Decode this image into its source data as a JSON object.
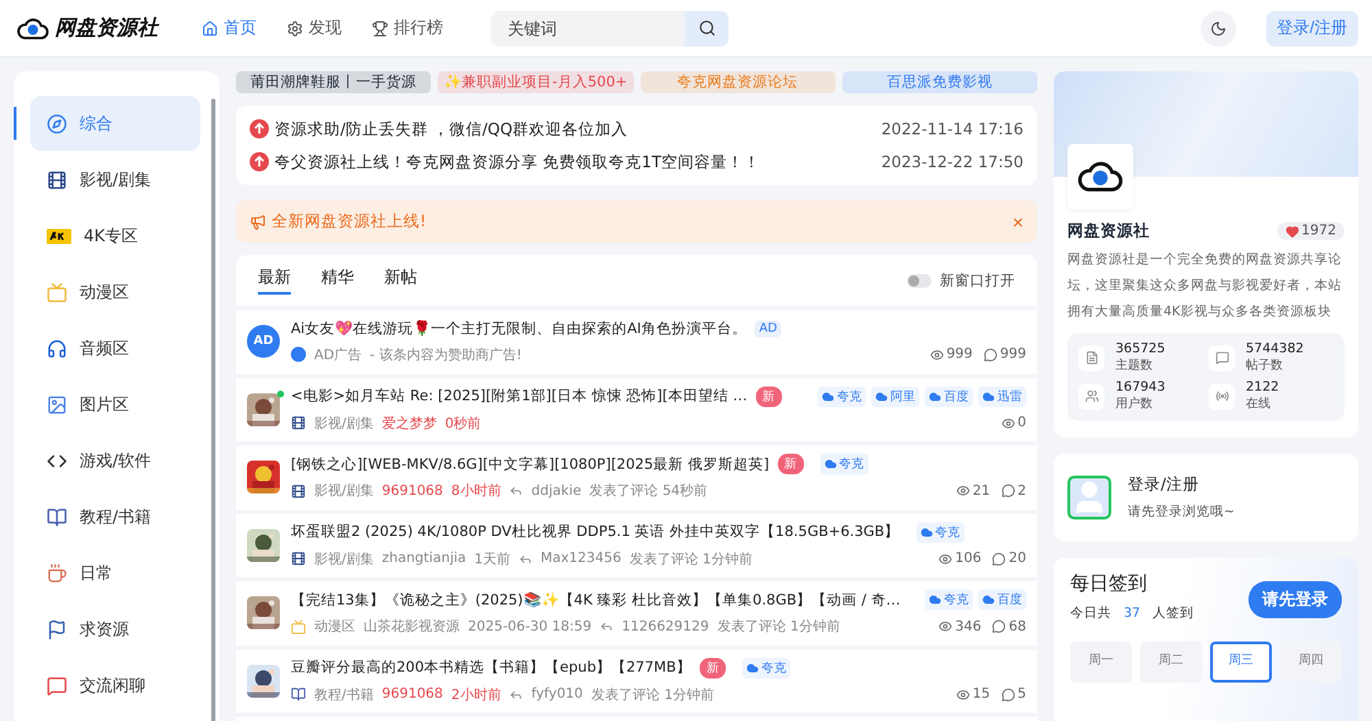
{
  "header": {
    "logo": "网盘资源社",
    "nav": [
      {
        "label": "首页",
        "selected": true
      },
      {
        "label": "发现",
        "selected": false
      },
      {
        "label": "排行榜",
        "selected": false
      }
    ],
    "search": {
      "placeholder": "关键词"
    },
    "login": "登录/注册"
  },
  "sidebar": {
    "items": [
      {
        "label": "综合",
        "selected": true
      },
      {
        "label": "影视/剧集",
        "selected": false
      },
      {
        "label": "4K专区",
        "selected": false
      },
      {
        "label": "动漫区",
        "selected": false
      },
      {
        "label": "音频区",
        "selected": false
      },
      {
        "label": "图片区",
        "selected": false
      },
      {
        "label": "游戏/软件",
        "selected": false
      },
      {
        "label": "教程/书籍",
        "selected": false
      },
      {
        "label": "日常",
        "selected": false
      },
      {
        "label": "求资源",
        "selected": false
      },
      {
        "label": "交流闲聊",
        "selected": false
      }
    ]
  },
  "promo_links": [
    {
      "label": "莆田潮牌鞋服丨一手货源",
      "color": "#1f2937"
    },
    {
      "label": "✨兼职副业项目-月入500+",
      "color": "#e5484d"
    },
    {
      "label": "夸克网盘资源论坛",
      "color": "#ea7a1a"
    },
    {
      "label": "百思派免费影视",
      "color": "#2f7bf0"
    }
  ],
  "announcements": [
    {
      "title": "资源求助/防止丢失群 ，微信/QQ群欢迎各位加入",
      "date": "2022-11-14 17:16"
    },
    {
      "title": "夸父资源社上线！夸克网盘资源分享 免费领取夸克1T空间容量！！",
      "date": "2023-12-22 17:50"
    }
  ],
  "notice": {
    "text": "全新网盘资源社上线!",
    "close": "×"
  },
  "feed_tabs": [
    {
      "label": "最新",
      "selected": true
    },
    {
      "label": "精华",
      "selected": false
    },
    {
      "label": "新帖",
      "selected": false
    }
  ],
  "new_window": {
    "label": "新窗口打开",
    "on": false
  },
  "posts": [
    {
      "kind": "ad",
      "avatar_text": "AD",
      "online": false,
      "title": "Ai女友💖在线游玩🌹一个主打无限制、自由探索的AI角色扮演平台。",
      "ad_badge": "AD",
      "category": "AD广告",
      "author": "- 该条内容为赞助商广告!",
      "highlight": false,
      "views": "999",
      "comments": "999"
    },
    {
      "kind": "picture",
      "online": true,
      "title": "<电影>如月车站 Re: [2025][附第1部][日本 惊悚 恐怖][本田望结 …",
      "new_badge": "新",
      "tags": [
        "夸克",
        "阿里",
        "百度",
        "迅雷"
      ],
      "category": "影视/剧集",
      "author": "爱之梦梦",
      "time": "0秒前",
      "highlight": true,
      "views": "0"
    },
    {
      "kind": "picture",
      "online": false,
      "title": "[钢铁之心][WEB-MKV/8.6G][中文字幕][1080P][2025最新 俄罗斯超英]",
      "new_badge": "新",
      "tags": [
        "夸克"
      ],
      "category": "影视/剧集",
      "author": "9691068",
      "time": "8小时前",
      "highlight": true,
      "replier": "ddjakie",
      "action": "发表了评论",
      "reply_time": "54秒前",
      "views": "21",
      "comments": "2"
    },
    {
      "kind": "picture",
      "online": false,
      "title": "坏蛋联盟2 (2025) 4K/1080P DV杜比视界 DDP5.1 英语 外挂中英双字【18.5GB+6.3GB】",
      "tags": [
        "夸克"
      ],
      "category": "影视/剧集",
      "author": "zhangtianjia",
      "time": "1天前",
      "highlight": false,
      "replier": "Max123456",
      "action": "发表了评论",
      "reply_time": "1分钟前",
      "views": "106",
      "comments": "20"
    },
    {
      "kind": "picture",
      "online": false,
      "title": "【完结13集】《诡秘之主》(2025)📚✨【4K 臻彩 杜比音效】【单集0.8GB】【动画 / 奇…",
      "tags": [
        "夸克",
        "百度"
      ],
      "category": "动漫区",
      "author": "山茶花影视资源",
      "time": "2025-06-30 18:59",
      "highlight": false,
      "replier": "1126629129",
      "action": "发表了评论",
      "reply_time": "1分钟前",
      "views": "346",
      "comments": "68"
    },
    {
      "kind": "picture",
      "online": false,
      "title": "豆瓣评分最高的200本书精选【书籍】【epub】【277MB】",
      "new_badge": "新",
      "tags": [
        "夸克"
      ],
      "category": "教程/书籍",
      "author": "9691068",
      "time": "2小时前",
      "highlight": true,
      "replier": "fyfy010",
      "action": "发表了评论",
      "reply_time": "1分钟前",
      "views": "15",
      "comments": "5"
    }
  ],
  "site_card": {
    "name": "网盘资源社",
    "likes": "1972",
    "description": "网盘资源社是一个完全免费的网盘资源共享论坛，这里聚集这众多网盘与影视爱好者，本站拥有大量高质量4K影视与众多各类资源板块",
    "stats": [
      {
        "value": "365725",
        "label": "主题数"
      },
      {
        "value": "5744382",
        "label": "帖子数"
      },
      {
        "value": "167943",
        "label": "用户数"
      },
      {
        "value": "2122",
        "label": "在线"
      }
    ]
  },
  "login_card": {
    "title": "登录/注册",
    "subtitle": "请先登录浏览哦~"
  },
  "checkin": {
    "title": "每日签到",
    "prefix": "今日共",
    "count": "37",
    "suffix": "人签到",
    "button": "请先登录",
    "days": [
      {
        "label": "周一",
        "selected": false
      },
      {
        "label": "周二",
        "selected": false
      },
      {
        "label": "周三",
        "selected": true
      },
      {
        "label": "周四",
        "selected": false
      }
    ]
  }
}
